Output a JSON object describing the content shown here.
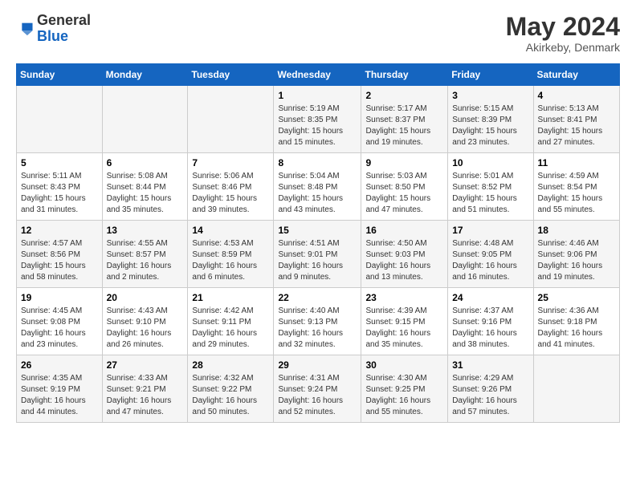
{
  "header": {
    "logo_general": "General",
    "logo_blue": "Blue",
    "month_title": "May 2024",
    "location": "Akirkeby, Denmark"
  },
  "days_of_week": [
    "Sunday",
    "Monday",
    "Tuesday",
    "Wednesday",
    "Thursday",
    "Friday",
    "Saturday"
  ],
  "weeks": [
    [
      {
        "day": "",
        "info": ""
      },
      {
        "day": "",
        "info": ""
      },
      {
        "day": "",
        "info": ""
      },
      {
        "day": "1",
        "info": "Sunrise: 5:19 AM\nSunset: 8:35 PM\nDaylight: 15 hours\nand 15 minutes."
      },
      {
        "day": "2",
        "info": "Sunrise: 5:17 AM\nSunset: 8:37 PM\nDaylight: 15 hours\nand 19 minutes."
      },
      {
        "day": "3",
        "info": "Sunrise: 5:15 AM\nSunset: 8:39 PM\nDaylight: 15 hours\nand 23 minutes."
      },
      {
        "day": "4",
        "info": "Sunrise: 5:13 AM\nSunset: 8:41 PM\nDaylight: 15 hours\nand 27 minutes."
      }
    ],
    [
      {
        "day": "5",
        "info": "Sunrise: 5:11 AM\nSunset: 8:43 PM\nDaylight: 15 hours\nand 31 minutes."
      },
      {
        "day": "6",
        "info": "Sunrise: 5:08 AM\nSunset: 8:44 PM\nDaylight: 15 hours\nand 35 minutes."
      },
      {
        "day": "7",
        "info": "Sunrise: 5:06 AM\nSunset: 8:46 PM\nDaylight: 15 hours\nand 39 minutes."
      },
      {
        "day": "8",
        "info": "Sunrise: 5:04 AM\nSunset: 8:48 PM\nDaylight: 15 hours\nand 43 minutes."
      },
      {
        "day": "9",
        "info": "Sunrise: 5:03 AM\nSunset: 8:50 PM\nDaylight: 15 hours\nand 47 minutes."
      },
      {
        "day": "10",
        "info": "Sunrise: 5:01 AM\nSunset: 8:52 PM\nDaylight: 15 hours\nand 51 minutes."
      },
      {
        "day": "11",
        "info": "Sunrise: 4:59 AM\nSunset: 8:54 PM\nDaylight: 15 hours\nand 55 minutes."
      }
    ],
    [
      {
        "day": "12",
        "info": "Sunrise: 4:57 AM\nSunset: 8:56 PM\nDaylight: 15 hours\nand 58 minutes."
      },
      {
        "day": "13",
        "info": "Sunrise: 4:55 AM\nSunset: 8:57 PM\nDaylight: 16 hours\nand 2 minutes."
      },
      {
        "day": "14",
        "info": "Sunrise: 4:53 AM\nSunset: 8:59 PM\nDaylight: 16 hours\nand 6 minutes."
      },
      {
        "day": "15",
        "info": "Sunrise: 4:51 AM\nSunset: 9:01 PM\nDaylight: 16 hours\nand 9 minutes."
      },
      {
        "day": "16",
        "info": "Sunrise: 4:50 AM\nSunset: 9:03 PM\nDaylight: 16 hours\nand 13 minutes."
      },
      {
        "day": "17",
        "info": "Sunrise: 4:48 AM\nSunset: 9:05 PM\nDaylight: 16 hours\nand 16 minutes."
      },
      {
        "day": "18",
        "info": "Sunrise: 4:46 AM\nSunset: 9:06 PM\nDaylight: 16 hours\nand 19 minutes."
      }
    ],
    [
      {
        "day": "19",
        "info": "Sunrise: 4:45 AM\nSunset: 9:08 PM\nDaylight: 16 hours\nand 23 minutes."
      },
      {
        "day": "20",
        "info": "Sunrise: 4:43 AM\nSunset: 9:10 PM\nDaylight: 16 hours\nand 26 minutes."
      },
      {
        "day": "21",
        "info": "Sunrise: 4:42 AM\nSunset: 9:11 PM\nDaylight: 16 hours\nand 29 minutes."
      },
      {
        "day": "22",
        "info": "Sunrise: 4:40 AM\nSunset: 9:13 PM\nDaylight: 16 hours\nand 32 minutes."
      },
      {
        "day": "23",
        "info": "Sunrise: 4:39 AM\nSunset: 9:15 PM\nDaylight: 16 hours\nand 35 minutes."
      },
      {
        "day": "24",
        "info": "Sunrise: 4:37 AM\nSunset: 9:16 PM\nDaylight: 16 hours\nand 38 minutes."
      },
      {
        "day": "25",
        "info": "Sunrise: 4:36 AM\nSunset: 9:18 PM\nDaylight: 16 hours\nand 41 minutes."
      }
    ],
    [
      {
        "day": "26",
        "info": "Sunrise: 4:35 AM\nSunset: 9:19 PM\nDaylight: 16 hours\nand 44 minutes."
      },
      {
        "day": "27",
        "info": "Sunrise: 4:33 AM\nSunset: 9:21 PM\nDaylight: 16 hours\nand 47 minutes."
      },
      {
        "day": "28",
        "info": "Sunrise: 4:32 AM\nSunset: 9:22 PM\nDaylight: 16 hours\nand 50 minutes."
      },
      {
        "day": "29",
        "info": "Sunrise: 4:31 AM\nSunset: 9:24 PM\nDaylight: 16 hours\nand 52 minutes."
      },
      {
        "day": "30",
        "info": "Sunrise: 4:30 AM\nSunset: 9:25 PM\nDaylight: 16 hours\nand 55 minutes."
      },
      {
        "day": "31",
        "info": "Sunrise: 4:29 AM\nSunset: 9:26 PM\nDaylight: 16 hours\nand 57 minutes."
      },
      {
        "day": "",
        "info": ""
      }
    ]
  ]
}
